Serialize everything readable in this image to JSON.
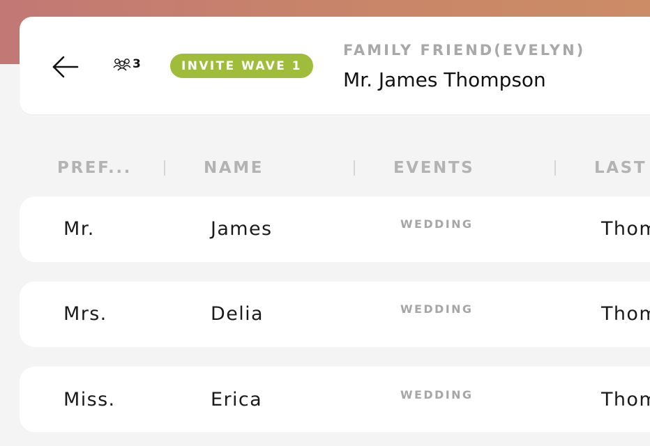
{
  "header": {
    "guest_count": "3",
    "invite_badge": "INVITE WAVE 1",
    "group_label": "FAMILY FRIEND(EVELYN)",
    "party_name": "Mr. James Thompson"
  },
  "table": {
    "columns": [
      "PREF...",
      "NAME",
      "EVENTS",
      "LAST"
    ],
    "rows": [
      {
        "prefix": "Mr.",
        "name": "James",
        "event": "WEDDING",
        "last": "Thom"
      },
      {
        "prefix": "Mrs.",
        "name": "Delia",
        "event": "WEDDING",
        "last": "Thom"
      },
      {
        "prefix": "Miss.",
        "name": "Erica",
        "event": "WEDDING",
        "last": "Thom"
      }
    ]
  },
  "colors": {
    "badge": "#9fbd3a",
    "gradient_start": "#c27874",
    "gradient_end": "#cc8c66",
    "background": "#f4f4f4"
  },
  "icons": {
    "back": "arrow-left-icon",
    "guests": "people-group-icon"
  }
}
